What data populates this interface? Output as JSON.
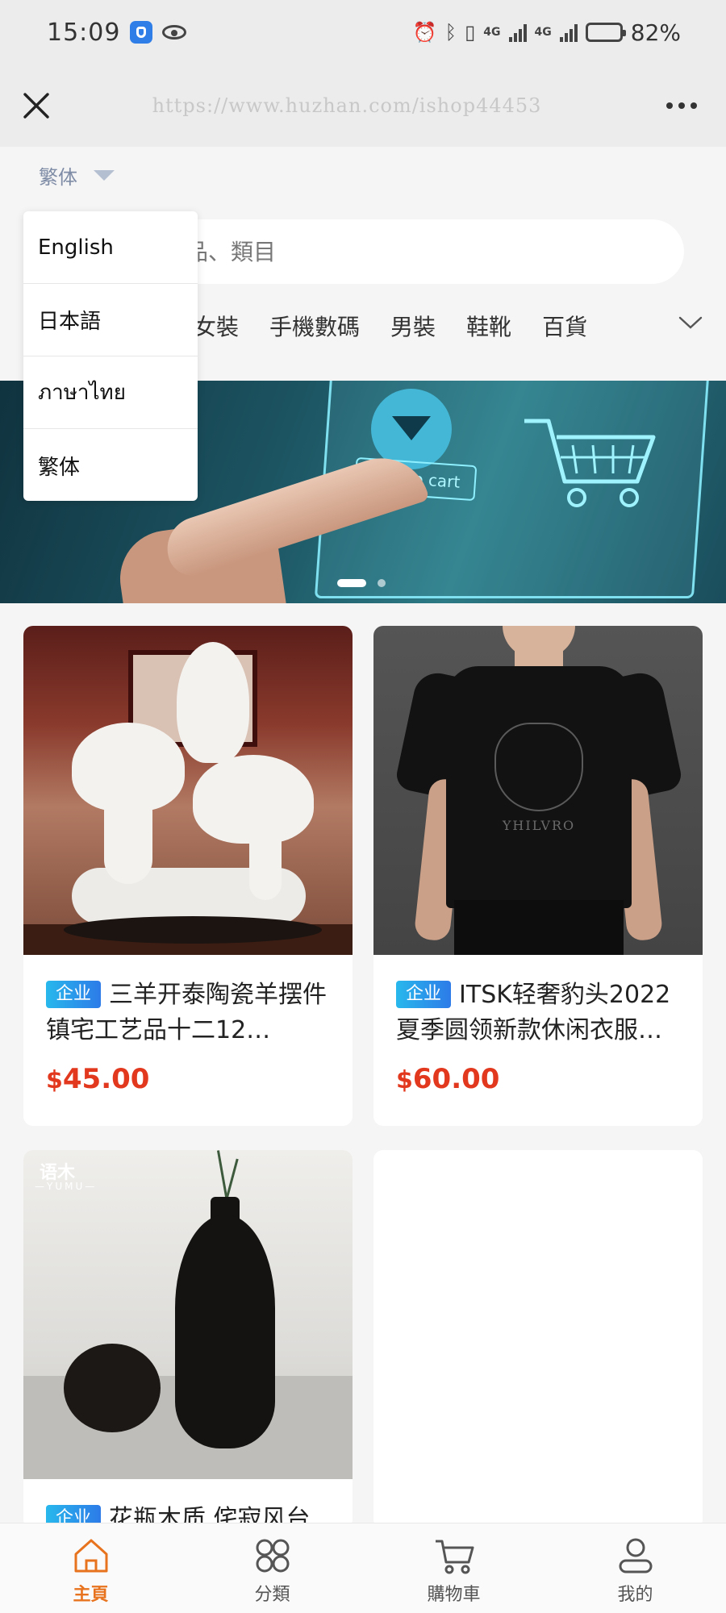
{
  "status_bar": {
    "time": "15:09",
    "network_1": "4G",
    "network_2": "4G",
    "battery_percent": "82%",
    "battery_level": 0.82
  },
  "browser": {
    "url": "https://www.huzhan.com/ishop44453"
  },
  "language": {
    "current": "繁体",
    "options": [
      "English",
      "日本語",
      "ภาษาไทย",
      "繁体"
    ]
  },
  "search": {
    "placeholder_visible": "品、類目"
  },
  "categories": [
    "女裝",
    "手機數碼",
    "男裝",
    "鞋靴",
    "百貨"
  ],
  "banner": {
    "button_text": "Add to cart",
    "slide_count": 2,
    "active_slide": 1
  },
  "products": [
    {
      "badge": "企业",
      "title": "三羊开泰陶瓷羊摆件镇宅工艺品十二12…",
      "currency": "$",
      "price": "45.00"
    },
    {
      "badge": "企业",
      "title": "ITSK轻奢豹头2022夏季圆领新款休闲衣服…",
      "currency": "$",
      "price": "60.00",
      "image_brand": "YHILVRO"
    },
    {
      "badge": "企业",
      "title": "花瓶木质 侘寂风台",
      "image_tag": "语木",
      "image_tag_sub": "—YUMU—"
    }
  ],
  "bottom_nav": [
    {
      "label": "主頁",
      "icon": "home-icon",
      "active": true
    },
    {
      "label": "分類",
      "icon": "category-icon",
      "active": false
    },
    {
      "label": "購物車",
      "icon": "cart-icon",
      "active": false
    },
    {
      "label": "我的",
      "icon": "user-icon",
      "active": false
    }
  ],
  "colors": {
    "accent": "#e8731e",
    "price": "#e2381e",
    "badge": "#2d7be8"
  }
}
